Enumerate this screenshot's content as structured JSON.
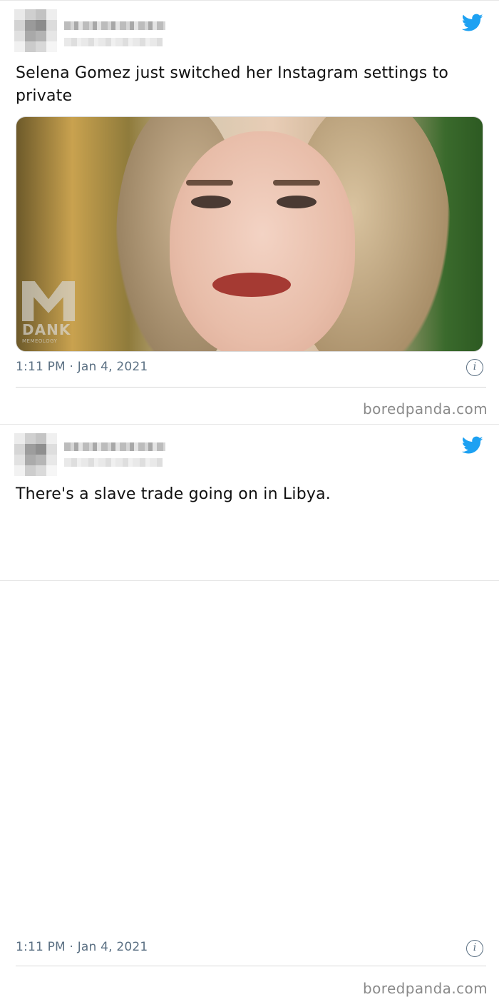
{
  "tweets": [
    {
      "text": "Selena Gomez just switched her Instagram settings to private",
      "time": "1:11 PM · Jan 4, 2021",
      "image_icon": "photo-of-woman",
      "watermark_logo": "DANK MEMEOLOGY",
      "info_icon": "info-icon",
      "source": "boredpanda.com"
    },
    {
      "text": "There's a slave trade going on in Libya.",
      "time": "1:11 PM · Jan 4, 2021",
      "info_icon": "info-icon",
      "source": "boredpanda.com"
    }
  ],
  "colors": {
    "twitter_blue": "#1da1f2",
    "meta_gray": "#5b7083",
    "source_gray": "#8a8a8a"
  }
}
